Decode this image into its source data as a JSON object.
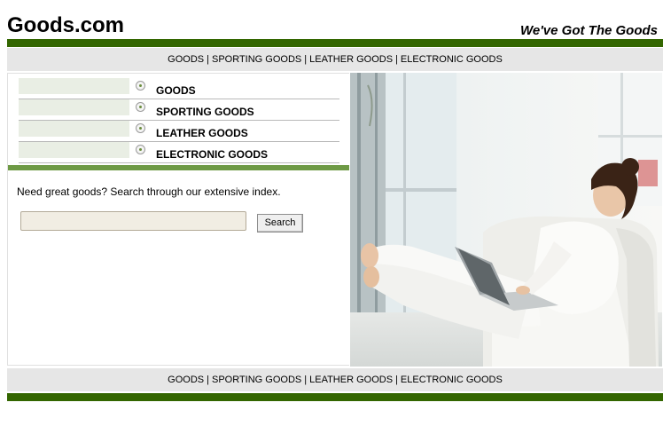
{
  "header": {
    "logo": "Goods.com",
    "tagline": "We've Got The Goods"
  },
  "top_nav": {
    "items": [
      "GOODS",
      "SPORTING GOODS",
      "LEATHER GOODS",
      "ELECTRONIC GOODS"
    ],
    "separator": "|"
  },
  "menu": {
    "items": [
      "GOODS",
      "SPORTING GOODS",
      "LEATHER GOODS",
      "ELECTRONIC GOODS"
    ]
  },
  "search": {
    "intro": "Need great goods? Search through our extensive index.",
    "placeholder": "",
    "value": "",
    "button_label": "Search"
  },
  "bottom_nav": {
    "items": [
      "GOODS",
      "SPORTING GOODS",
      "LEATHER GOODS",
      "ELECTRONIC GOODS"
    ],
    "separator": "|"
  },
  "colors": {
    "bar_dark_green": "#336600",
    "divider_green": "#6e9a45",
    "nav_background": "#e6e6e6",
    "menu_swatch": "#e9eee4",
    "search_field": "#f1ede3"
  },
  "hero_image": {
    "icon": "photo-woman-with-laptop-icon"
  }
}
